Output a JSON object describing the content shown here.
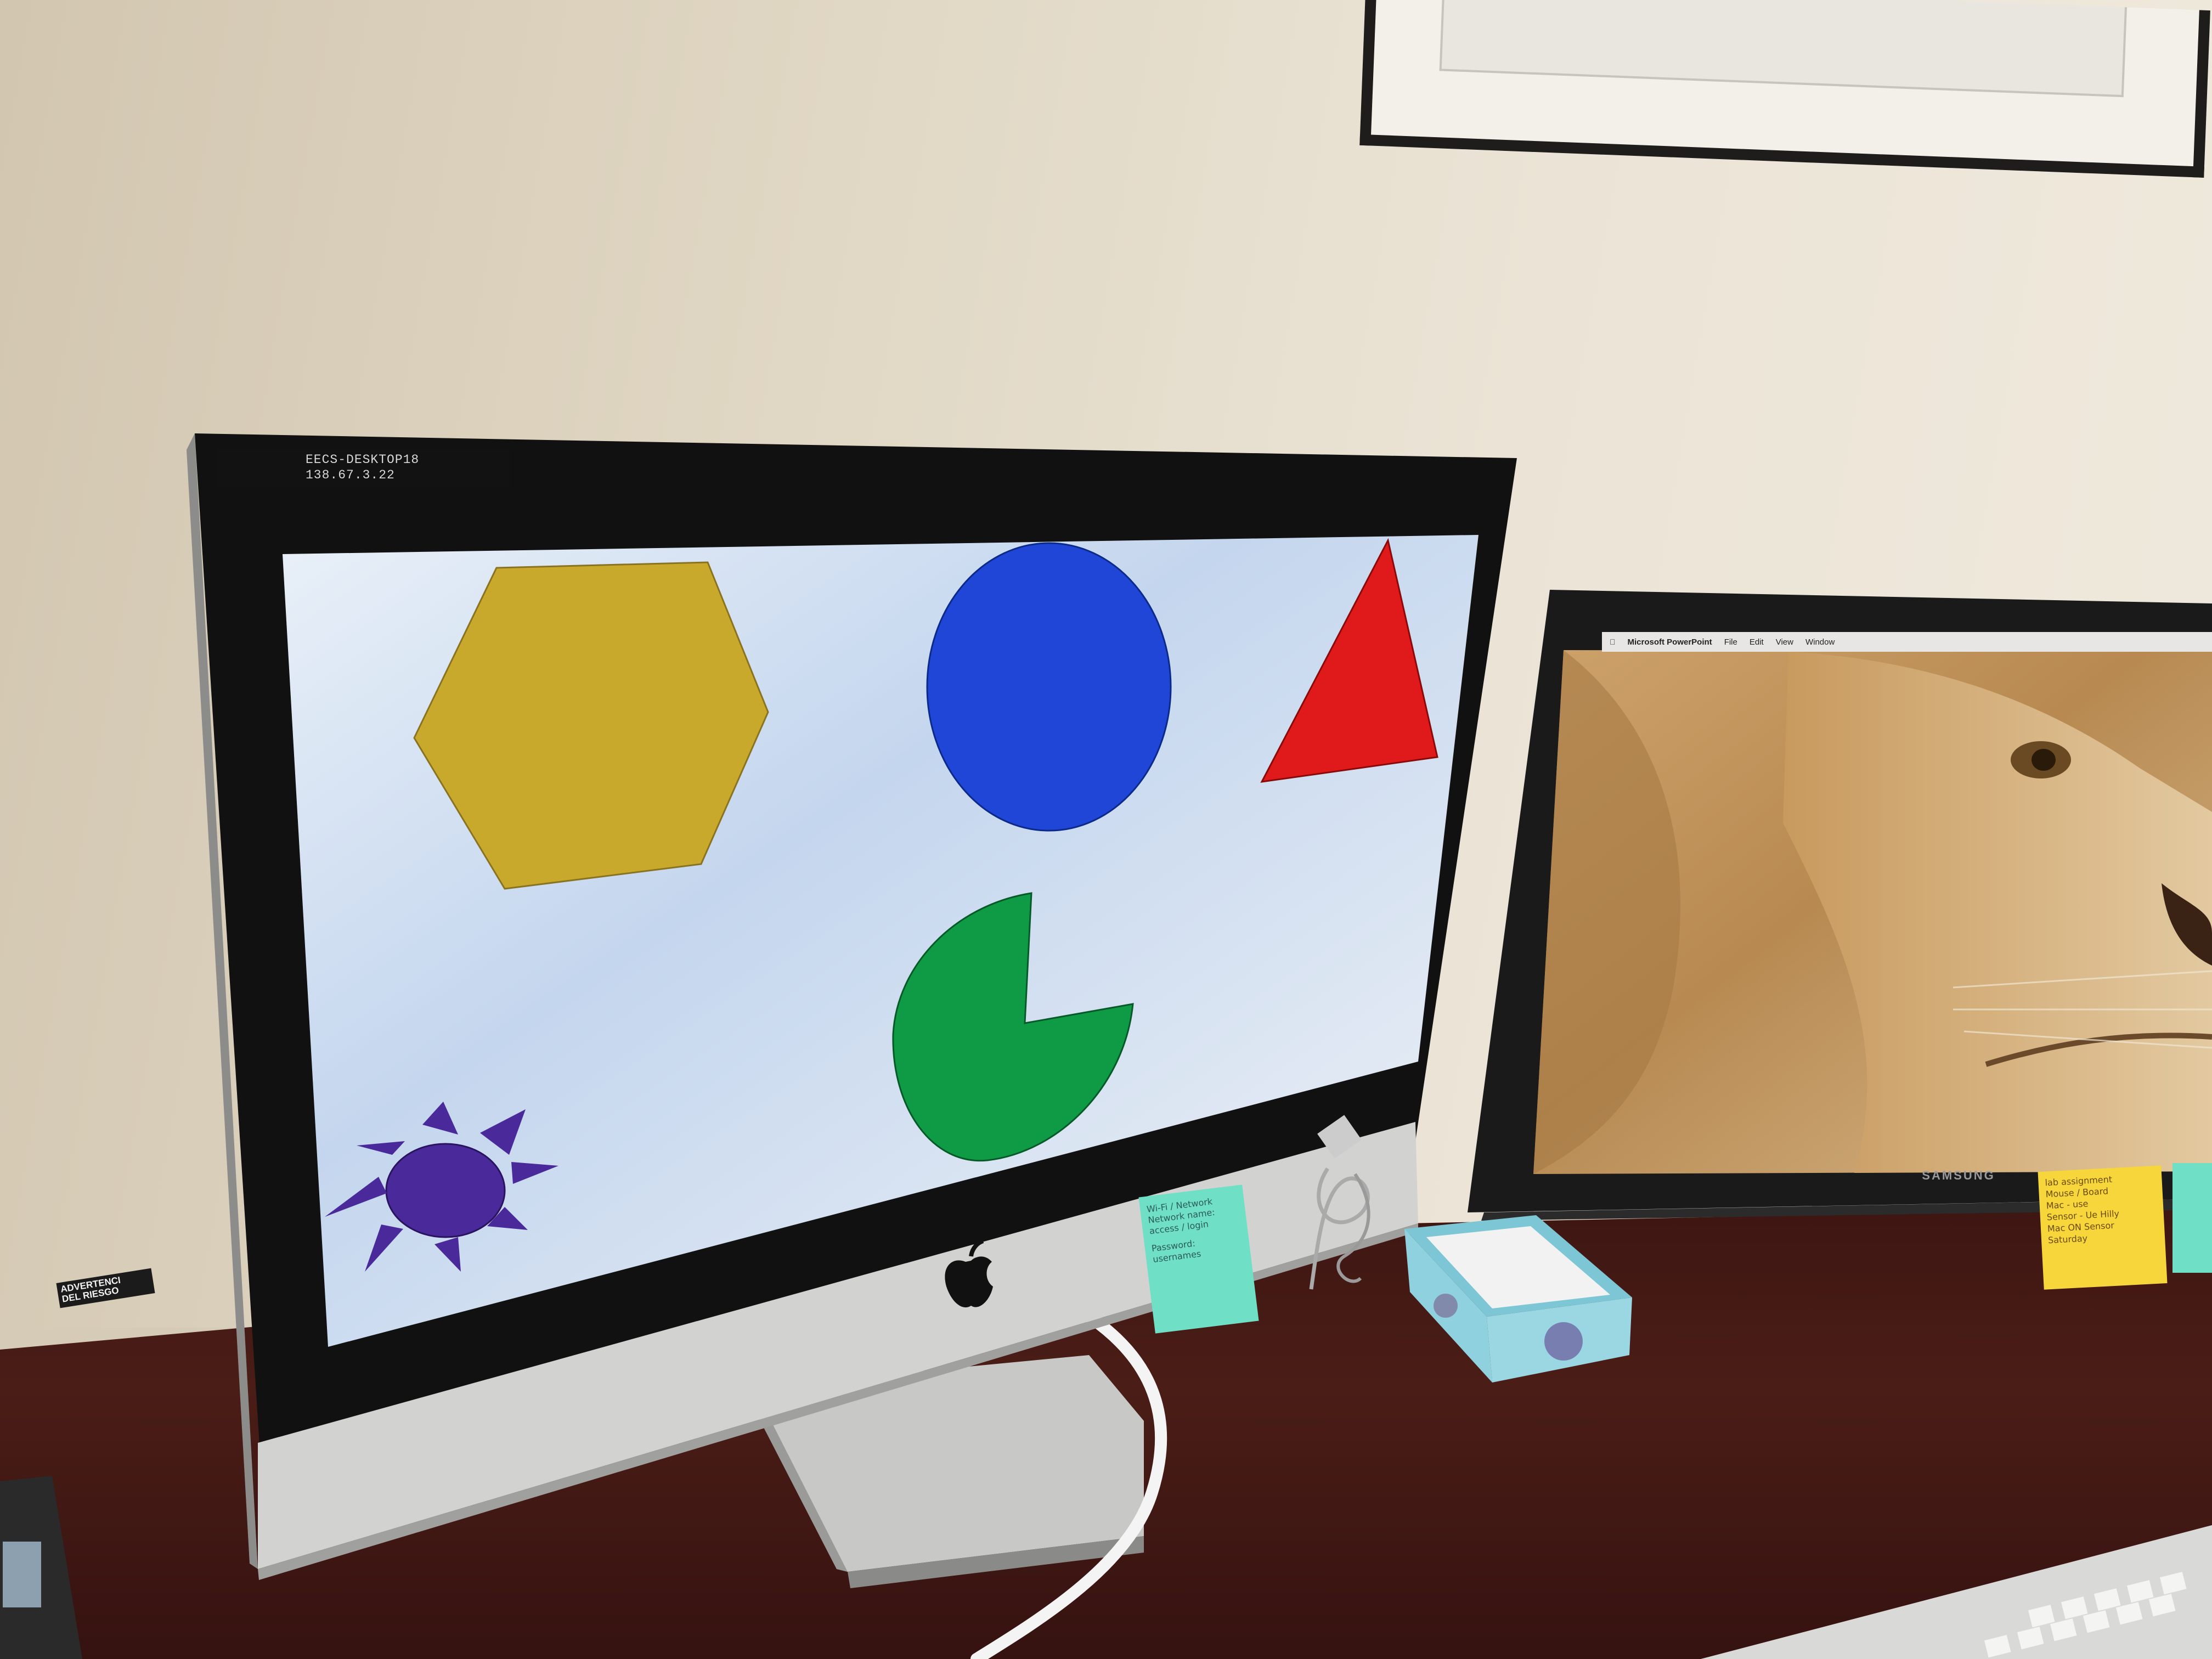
{
  "imac": {
    "hostname": "EECS-DESKTOP18",
    "ip_address": "138.67.3.22"
  },
  "imac_screen": {
    "background_color": "#e8eef6",
    "shapes": [
      {
        "name": "hexagon",
        "color": "#c9a92c"
      },
      {
        "name": "circle",
        "color": "#1f46d6"
      },
      {
        "name": "triangle",
        "color": "#e01a1a"
      },
      {
        "name": "pac-man",
        "color": "#0f9a45"
      },
      {
        "name": "sun",
        "color": "#4a2a9a"
      }
    ]
  },
  "samsung_monitor": {
    "brand": "SAMSUNG",
    "menu_bar": {
      "app_name": "Microsoft PowerPoint",
      "items": [
        "File",
        "Edit",
        "View",
        "Window"
      ]
    },
    "wallpaper": "lion-photo"
  },
  "sticky_notes": {
    "teal": {
      "lines": [
        "Wi-Fi / Network",
        "Network name:",
        "access / login",
        "Password:",
        "usernames"
      ]
    },
    "yellow": {
      "lines": [
        "lab assignment",
        "Mouse / Board",
        "Mac - use",
        "Sensor - Ue  Hilly",
        "Mac ON  Sensor",
        "Saturday"
      ]
    }
  },
  "warning_sticker": {
    "lines": [
      "ADVERTENCI",
      "DEL RIESGO"
    ]
  }
}
